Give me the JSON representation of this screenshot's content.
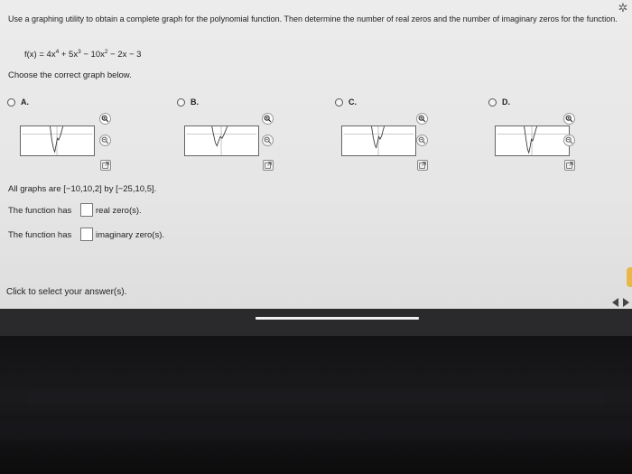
{
  "question": {
    "prompt": "Use a graphing utility to obtain a complete graph for the polynomial function. Then determine the number of real zeros and the number of imaginary zeros for the function.",
    "function": {
      "lhs": "f(x) = 4x",
      "exp1": "4",
      "t2": " + 5x",
      "exp2": "3",
      "t3": " − 10x",
      "exp3": "2",
      "t4": " − 2x − 3"
    },
    "choose_text": "Choose the correct graph below."
  },
  "options": [
    {
      "letter": "A.",
      "selected": false
    },
    {
      "letter": "B.",
      "selected": false
    },
    {
      "letter": "C.",
      "selected": false
    },
    {
      "letter": "D.",
      "selected": false
    }
  ],
  "icons": {
    "zoom_in": "magnify-plus-icon",
    "zoom_out": "magnify-minus-icon",
    "popout": "external-window-icon",
    "settings": "gear-icon",
    "prev": "triangle-left-icon",
    "next": "triangle-right-icon"
  },
  "window_text": "All graphs are [−10,10,2] by [−25,10,5].",
  "real_row": {
    "prefix": "The function has",
    "suffix": "real zero(s).",
    "value": ""
  },
  "imag_row": {
    "prefix": "The function has",
    "suffix": "imaginary zero(s).",
    "value": ""
  },
  "click_message": "Click to select your answer(s).",
  "colors": {
    "accent": "#2d6db5",
    "curve": "#3a3a3a",
    "screen_bg": "#e9e9e9"
  }
}
